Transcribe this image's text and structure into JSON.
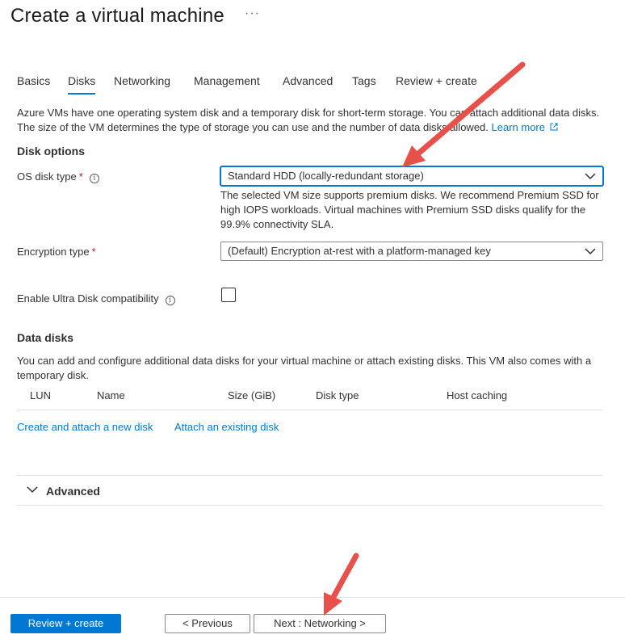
{
  "header": {
    "title": "Create a virtual machine",
    "more": "···"
  },
  "tabs": [
    {
      "label": "Basics"
    },
    {
      "label": "Disks"
    },
    {
      "label": "Networking"
    },
    {
      "label": "Management"
    },
    {
      "label": "Advanced"
    },
    {
      "label": "Tags"
    },
    {
      "label": "Review + create"
    }
  ],
  "active_tab": "Disks",
  "intro": {
    "line1": "Azure VMs have one operating system disk and a temporary disk for short-term storage. You can attach additional data disks.",
    "line2": "The size of the VM determines the type of storage you can use and the number of data disks allowed.",
    "learn_more": "Learn more"
  },
  "disk_options": {
    "title": "Disk options",
    "os_disk_type": {
      "label": "OS disk type",
      "required": "*",
      "value": "Standard HDD (locally-redundant storage)",
      "helper": "The selected VM size supports premium disks. We recommend Premium SSD for high IOPS workloads. Virtual machines with Premium SSD disks qualify for the 99.9% connectivity SLA."
    },
    "encryption_type": {
      "label": "Encryption type",
      "required": "*",
      "value": "(Default) Encryption at-rest with a platform-managed key"
    },
    "ultra_disk": {
      "label": "Enable Ultra Disk compatibility",
      "checked": false
    }
  },
  "data_disks": {
    "title": "Data disks",
    "description": "You can add and configure additional data disks for your virtual machine or attach existing disks. This VM also comes with a temporary disk.",
    "columns": [
      "LUN",
      "Name",
      "Size (GiB)",
      "Disk type",
      "Host caching"
    ],
    "rows": [],
    "create_link": "Create and attach a new disk",
    "attach_link": "Attach an existing disk"
  },
  "advanced_section": {
    "label": "Advanced",
    "expanded": false
  },
  "footer": {
    "review_create": "Review + create",
    "previous": "< Previous",
    "next": "Next : Networking >"
  },
  "colors": {
    "accent": "#0078d4",
    "annotation_arrow": "#e8504a",
    "required": "#a4262c"
  }
}
